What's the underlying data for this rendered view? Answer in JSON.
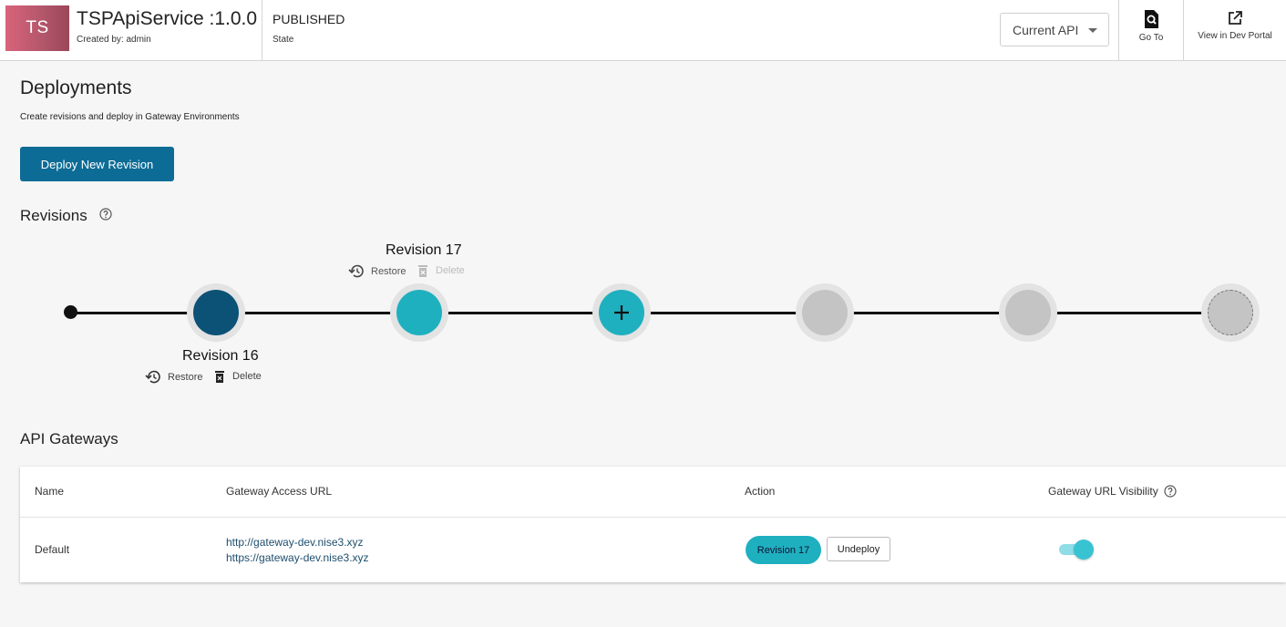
{
  "header": {
    "avatar_initials": "TS",
    "api_title": "TSPApiService :1.0.0",
    "created_by": "Created by: admin",
    "state_value": "PUBLISHED",
    "state_label": "State",
    "current_api_label": "Current API",
    "goto_label": "Go To",
    "dev_portal_label": "View in Dev Portal",
    "avatar_gradient": [
      "#d8647a",
      "#9b4658"
    ]
  },
  "deployments": {
    "title": "Deployments",
    "description": "Create revisions and deploy in Gateway Environments",
    "deploy_button_label": "Deploy New Revision"
  },
  "revisions": {
    "title": "Revisions",
    "items": [
      {
        "name": "Revision 16",
        "restore_label": "Restore",
        "delete_label": "Delete",
        "color": "#0c5176",
        "delete_enabled": true
      },
      {
        "name": "Revision 17",
        "restore_label": "Restore",
        "delete_label": "Delete",
        "color": "#1fb0c0",
        "delete_enabled": false
      }
    ],
    "add_symbol": "+"
  },
  "gateways": {
    "title": "API Gateways",
    "columns": {
      "name": "Name",
      "url": "Gateway Access URL",
      "action": "Action",
      "visibility": "Gateway URL Visibility"
    },
    "rows": [
      {
        "name": "Default",
        "url_http": "http://gateway-dev.nise3.xyz",
        "url_https": "https://gateway-dev.nise3.xyz",
        "revision_label": "Revision 17",
        "undeploy_label": "Undeploy",
        "visibility_on": true
      }
    ]
  },
  "colors": {
    "primary": "#0d6c96",
    "accent": "#1fb0c0",
    "deployed_revision": "#0c5176",
    "empty_slot": "#c4c4c4"
  }
}
